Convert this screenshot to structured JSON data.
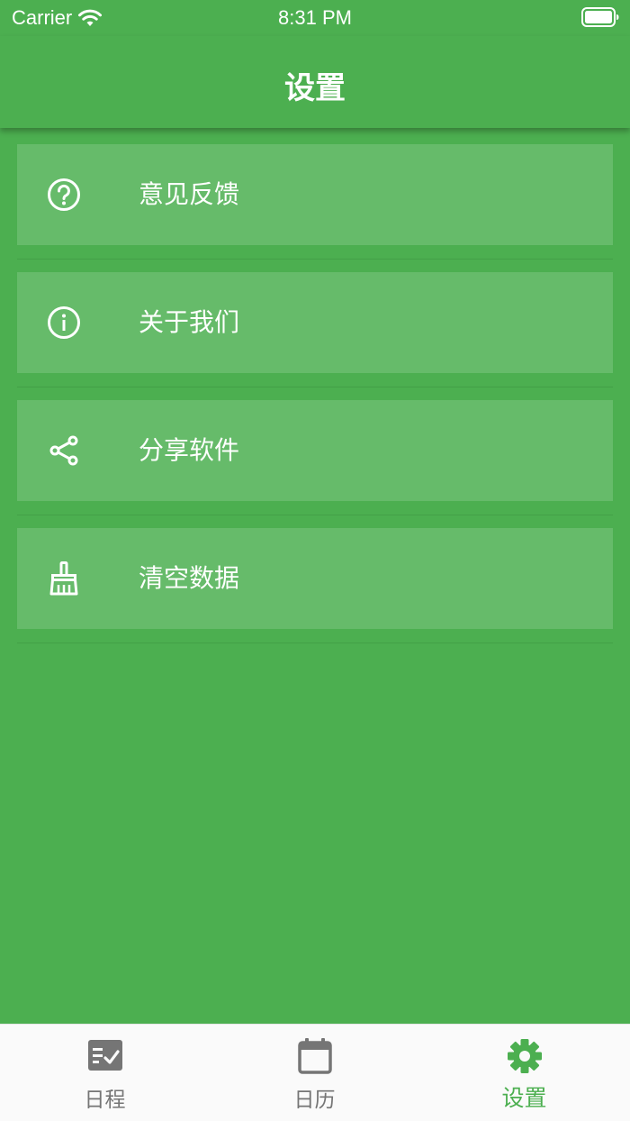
{
  "status_bar": {
    "carrier": "Carrier",
    "time": "8:31 PM"
  },
  "app_bar": {
    "title": "设置"
  },
  "settings": {
    "items": [
      {
        "label": "意见反馈",
        "icon": "help-circle-icon"
      },
      {
        "label": "关于我们",
        "icon": "info-icon"
      },
      {
        "label": "分享软件",
        "icon": "share-icon"
      },
      {
        "label": "清空数据",
        "icon": "broom-icon"
      }
    ]
  },
  "bottom_nav": {
    "tabs": [
      {
        "label": "日程",
        "icon": "schedule-list-icon",
        "active": false
      },
      {
        "label": "日历",
        "icon": "calendar-icon",
        "active": false
      },
      {
        "label": "设置",
        "icon": "gear-icon",
        "active": true
      }
    ]
  },
  "colors": {
    "primary": "#4caf50",
    "item_background": "#66bb6a",
    "nav_inactive": "#757575",
    "nav_background": "#fafafa"
  }
}
